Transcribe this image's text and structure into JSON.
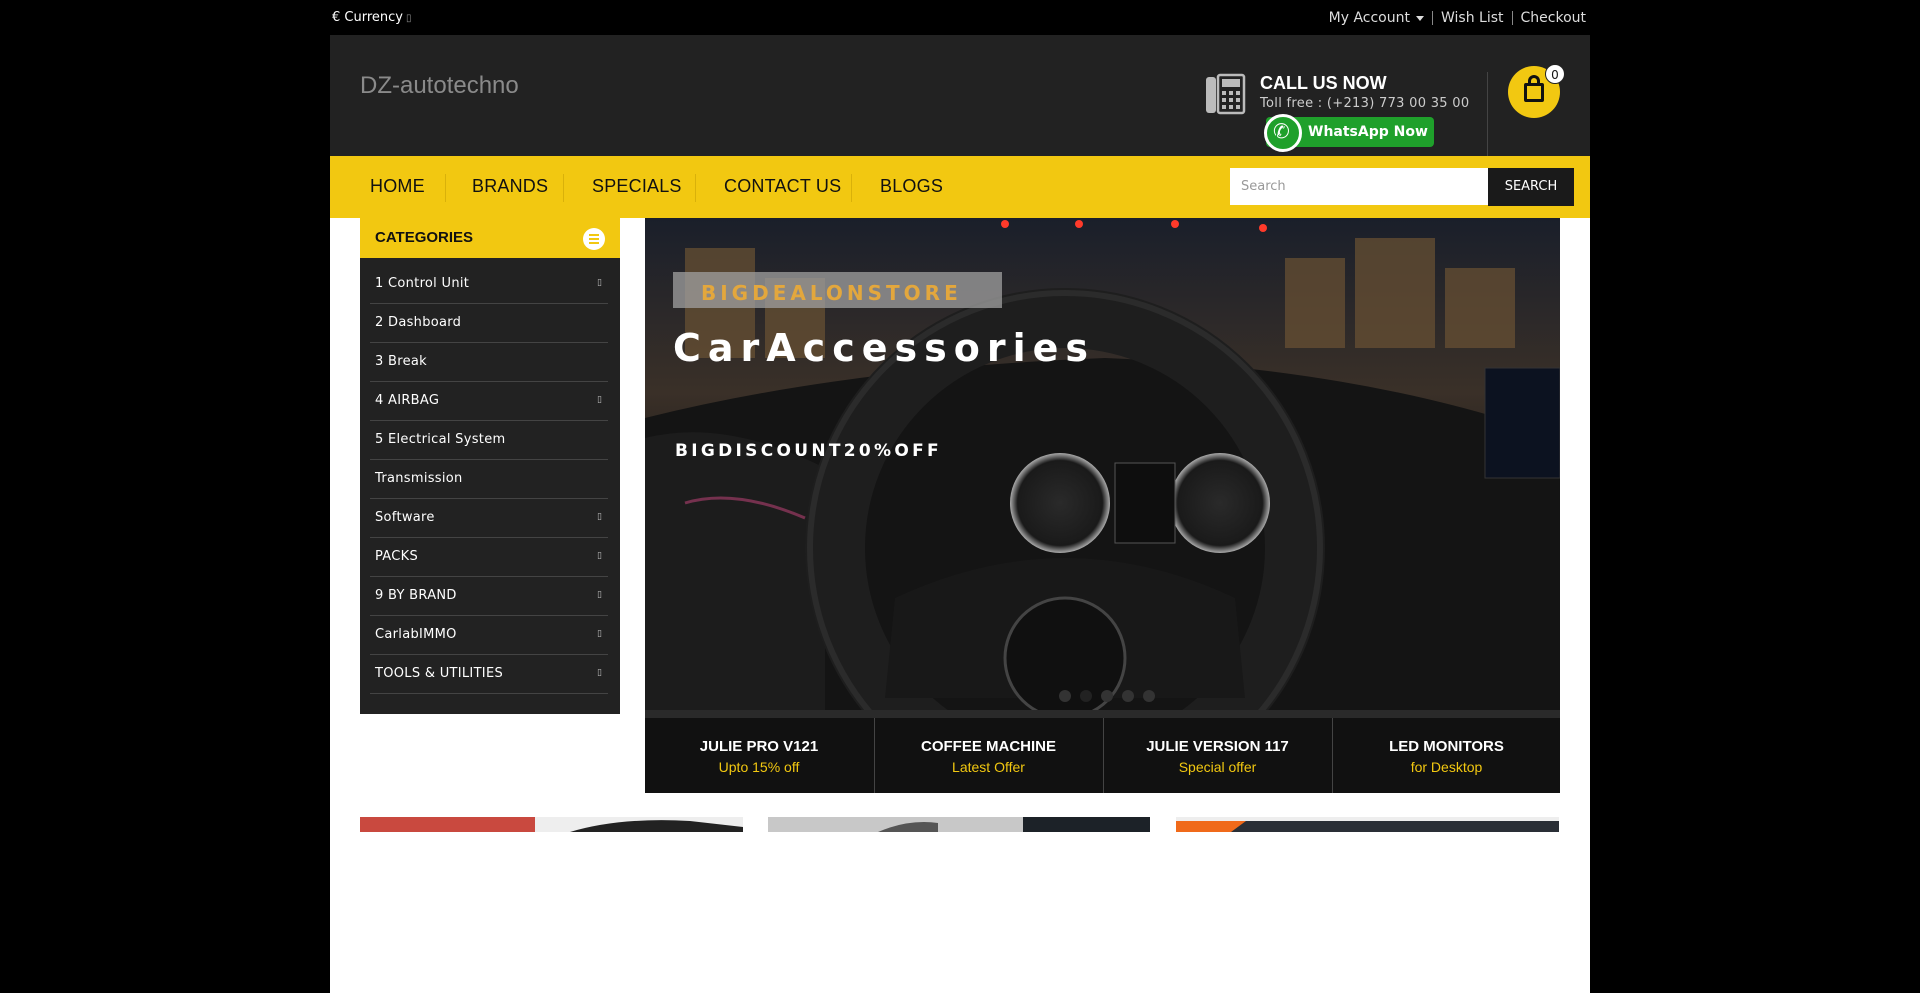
{
  "topbar": {
    "currency_label": "€ Currency",
    "links": {
      "account": "My Account",
      "wishlist": "Wish List",
      "checkout": "Checkout"
    }
  },
  "header": {
    "logo": "DZ-autotechno",
    "call_title": "CALL US NOW",
    "call_number": "Toll free : (+213) 773 00 35 00",
    "whatsapp_label": "WhatsApp Now",
    "cart_count": "0"
  },
  "nav": {
    "items": [
      "HOME",
      "BRANDS",
      "SPECIALS",
      "CONTACT US",
      "BLOGS"
    ],
    "search_placeholder": "Search",
    "search_button": "SEARCH"
  },
  "categories": {
    "title": "CATEGORIES",
    "items": [
      {
        "label": "1 Control Unit",
        "has_children": true
      },
      {
        "label": "2 Dashboard",
        "has_children": false
      },
      {
        "label": "3 Break",
        "has_children": false
      },
      {
        "label": "4 AIRBAG",
        "has_children": true
      },
      {
        "label": "5 Electrical System",
        "has_children": false
      },
      {
        "label": " Transmission",
        "has_children": false
      },
      {
        "label": " Software",
        "has_children": true
      },
      {
        "label": "PACKS",
        "has_children": true
      },
      {
        "label": "9 BY BRAND",
        "has_children": true
      },
      {
        "label": " CarlabIMMO",
        "has_children": true
      },
      {
        "label": " TOOLS & UTILITIES",
        "has_children": true
      }
    ]
  },
  "banner": {
    "brand": "BIGDEALONSTORE",
    "title": "CarAccessories",
    "subtitle": "BIGDISCOUNT20%OFF",
    "slide_count": 5,
    "active_slide": 2
  },
  "offers": [
    {
      "title": "JULIE PRO V121",
      "subtitle": "Upto 15% off"
    },
    {
      "title": "COFFEE MACHINE",
      "subtitle": "Latest Offer"
    },
    {
      "title": "JULIE VERSION 117",
      "subtitle": "Special offer"
    },
    {
      "title": "LED MONITORS",
      "subtitle": "for Desktop"
    }
  ],
  "colors": {
    "accent": "#f2c811",
    "header_bg": "#222222",
    "page_bg": "#000000",
    "whatsapp": "#1fa02b",
    "brand_text": "#e3a73d"
  }
}
